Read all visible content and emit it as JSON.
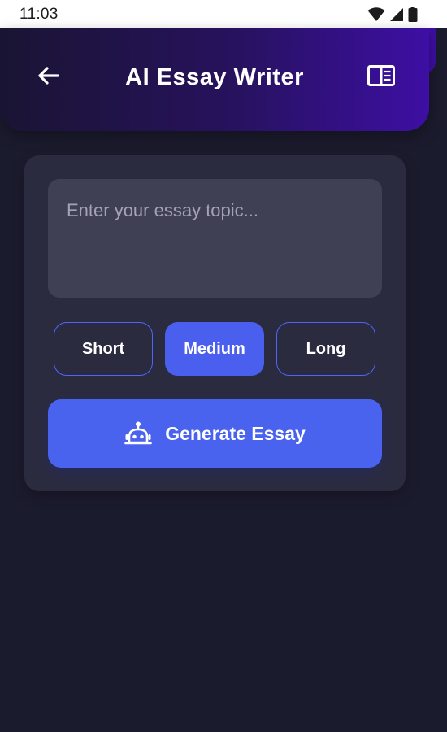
{
  "status_bar": {
    "time": "11:03",
    "icons": [
      "wifi-icon",
      "cellular-signal-icon",
      "battery-icon"
    ]
  },
  "header": {
    "title": "AI Essay Writer",
    "back_icon": "arrow-left-icon",
    "action_icon": "book-open-icon"
  },
  "form": {
    "topic_placeholder": "Enter your essay topic...",
    "topic_value": "",
    "length_options": [
      "Short",
      "Medium",
      "Long"
    ],
    "selected_length": "Medium",
    "generate_label": "Generate Essay",
    "generate_icon": "robot-icon"
  },
  "colors": {
    "background": "#1b1b2e",
    "card": "#2b2b40",
    "input": "#404055",
    "accent": "#4a63ee",
    "header_gradient_start": "#1a1433",
    "header_gradient_end": "#3d0fa4"
  }
}
